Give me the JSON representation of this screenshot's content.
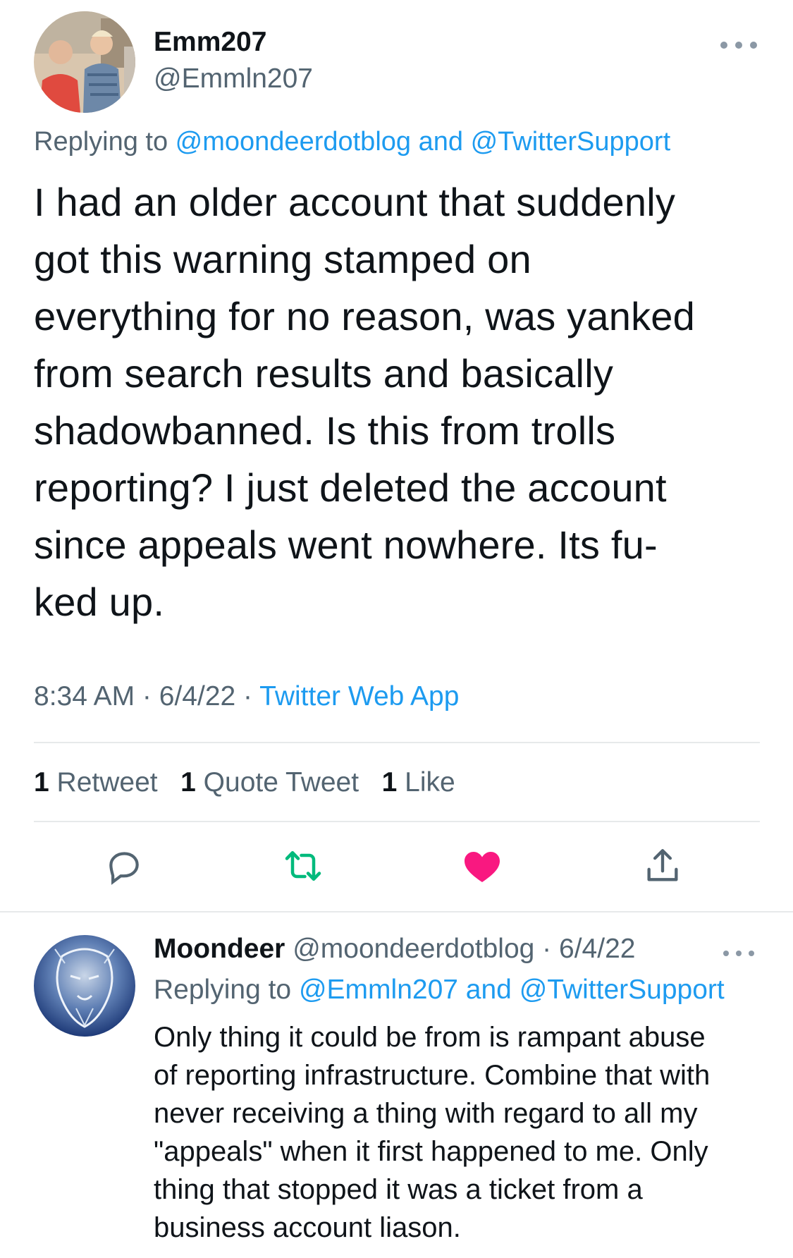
{
  "tweet": {
    "author_name": "Emm207",
    "author_handle": "@Emmln207",
    "replying_prefix": "Replying to ",
    "replying_to_1": "@moondeerdotblog",
    "replying_and": " and ",
    "replying_to_2": "@TwitterSupport",
    "text": "I had an older account that suddenly\ngot this warning stamped on\neverything for no reason, was yanked\nfrom search results and basically\nshadowbanned.  Is this from trolls\nreporting? I just deleted the account\nsince appeals went nowhere. Its fu-\nked up.",
    "time": "8:34 AM",
    "date": "6/4/22",
    "separator": " · ",
    "source": "Twitter Web App",
    "retweet_count": "1",
    "retweet_label": " Retweet",
    "quote_count": "1",
    "quote_label": " Quote Tweet",
    "like_count": "1",
    "like_label": " Like"
  },
  "reply": {
    "author_name": "Moondeer",
    "author_handle": "@moondeerdotblog",
    "separator": " · ",
    "date": "6/4/22",
    "replying_prefix": "Replying to ",
    "replying_to_1": "@Emmln207",
    "replying_and": " and ",
    "replying_to_2": "@TwitterSupport",
    "text": "Only thing it could be from is rampant abuse\nof reporting infrastructure. Combine that with\nnever receiving a thing with regard to all my\n\"appeals\" when it first happened to me. Only\nthing that stopped it was a ticket from a\nbusiness account liason."
  },
  "colors": {
    "link": "#1d9bf0",
    "muted": "#536471",
    "retweet": "#00ba7c",
    "like": "#f91880"
  },
  "icons": [
    "more-icon",
    "reply-icon",
    "retweet-icon",
    "like-icon",
    "share-icon"
  ]
}
